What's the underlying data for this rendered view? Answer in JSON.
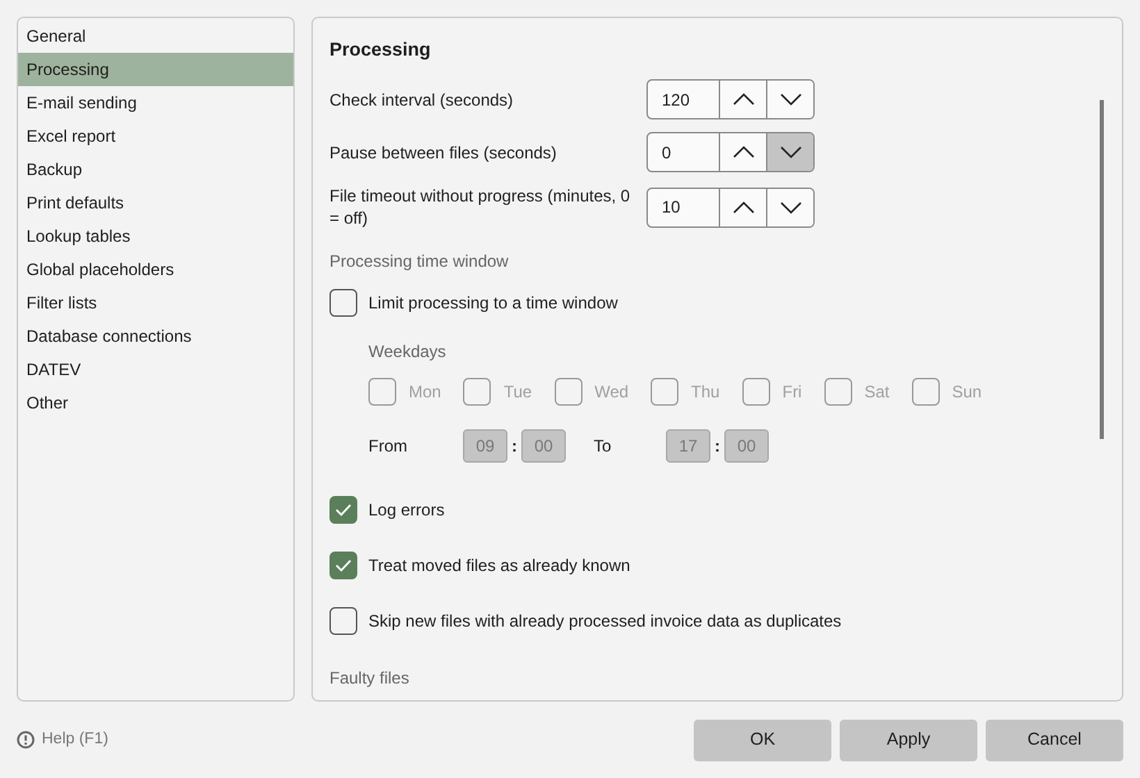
{
  "sidebar": {
    "items": [
      {
        "label": "General",
        "selected": false
      },
      {
        "label": "Processing",
        "selected": true
      },
      {
        "label": "E-mail sending",
        "selected": false
      },
      {
        "label": "Excel report",
        "selected": false
      },
      {
        "label": "Backup",
        "selected": false
      },
      {
        "label": "Print defaults",
        "selected": false
      },
      {
        "label": "Lookup tables",
        "selected": false
      },
      {
        "label": "Global placeholders",
        "selected": false
      },
      {
        "label": "Filter lists",
        "selected": false
      },
      {
        "label": "Database connections",
        "selected": false
      },
      {
        "label": "DATEV",
        "selected": false
      },
      {
        "label": "Other",
        "selected": false
      }
    ]
  },
  "section": {
    "title": "Processing",
    "spinners": [
      {
        "label": "Check interval (seconds)",
        "value": "120",
        "down_highlighted": false
      },
      {
        "label": "Pause between files (seconds)",
        "value": "0",
        "down_highlighted": true
      },
      {
        "label": "File timeout without progress (minutes, 0 = off)",
        "value": "10",
        "down_highlighted": false
      }
    ],
    "time_window": {
      "heading": "Processing time window",
      "limit": {
        "label": "Limit processing to a time window",
        "checked": false
      },
      "weekdays_label": "Weekdays",
      "days": [
        {
          "label": "Mon",
          "checked": false,
          "disabled": true
        },
        {
          "label": "Tue",
          "checked": false,
          "disabled": true
        },
        {
          "label": "Wed",
          "checked": false,
          "disabled": true
        },
        {
          "label": "Thu",
          "checked": false,
          "disabled": true
        },
        {
          "label": "Fri",
          "checked": false,
          "disabled": true
        },
        {
          "label": "Sat",
          "checked": false,
          "disabled": true
        },
        {
          "label": "Sun",
          "checked": false,
          "disabled": true
        }
      ],
      "times": [
        {
          "label": "From",
          "hour": "09",
          "separator": ":",
          "minute": "00",
          "disabled": true
        },
        {
          "label": "To",
          "hour": "17",
          "separator": ":",
          "minute": "00",
          "disabled": true
        }
      ]
    },
    "checkboxes": [
      {
        "label": "Log errors",
        "checked": true
      },
      {
        "label": "Treat moved files as already known",
        "checked": true
      },
      {
        "label": "Skip new files with already processed invoice data as duplicates",
        "checked": false
      }
    ],
    "next_heading": "Faulty files"
  },
  "footer": {
    "help": "Help (F1)",
    "buttons": [
      "OK",
      "Apply",
      "Cancel"
    ]
  }
}
